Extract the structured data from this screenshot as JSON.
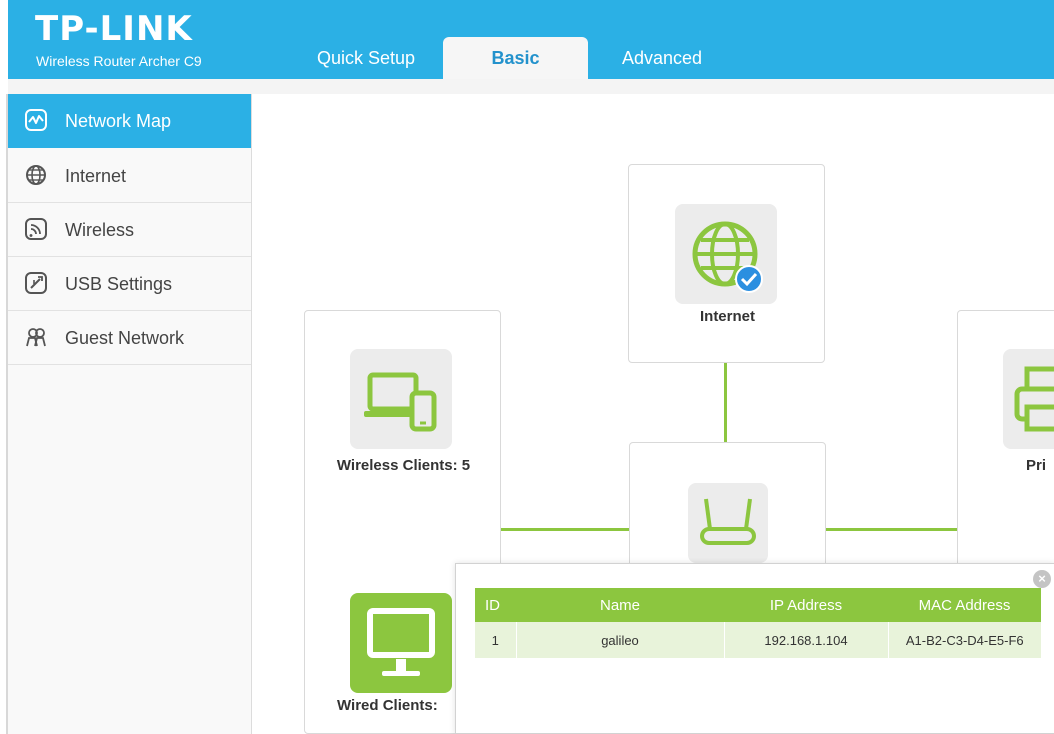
{
  "brand": {
    "logo": "TP-LINK",
    "model": "Wireless Router Archer C9"
  },
  "tabs": [
    {
      "label": "Quick Setup",
      "active": false
    },
    {
      "label": "Basic",
      "active": true
    },
    {
      "label": "Advanced",
      "active": false
    }
  ],
  "sidebar": {
    "items": [
      {
        "label": "Network Map",
        "icon": "network-map-icon",
        "active": true
      },
      {
        "label": "Internet",
        "icon": "globe-icon",
        "active": false
      },
      {
        "label": "Wireless",
        "icon": "wireless-icon",
        "active": false
      },
      {
        "label": "USB Settings",
        "icon": "usb-icon",
        "active": false
      },
      {
        "label": "Guest Network",
        "icon": "guests-icon",
        "active": false
      }
    ]
  },
  "map": {
    "internet_label": "Internet",
    "wireless_clients_label": "Wireless Clients: 5",
    "wired_clients_label": "Wired Clients:",
    "printer_label": "Pri"
  },
  "popup": {
    "columns": [
      "ID",
      "Name",
      "IP Address",
      "MAC Address"
    ],
    "rows": [
      [
        "1",
        "galileo",
        "192.168.1.104",
        "A1-B2-C3-D4-E5-F6"
      ]
    ]
  },
  "colors": {
    "header": "#2bb0e5",
    "accent_green": "#8cc63f",
    "check_blue": "#2b8fe0"
  }
}
